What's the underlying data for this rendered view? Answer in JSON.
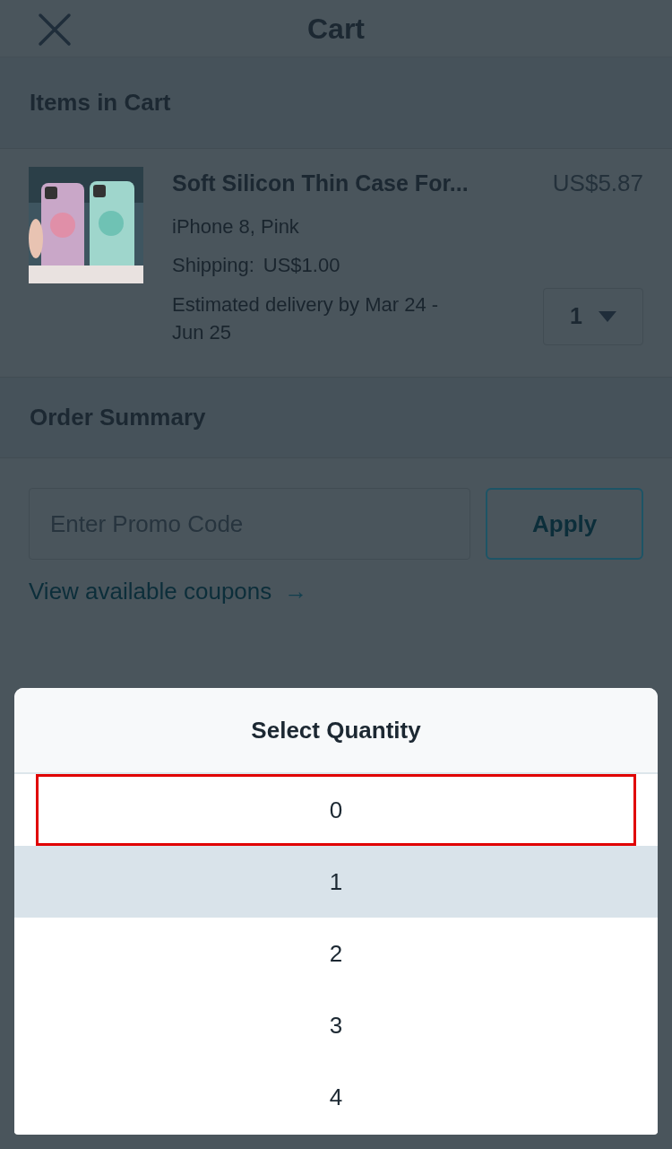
{
  "header": {
    "title": "Cart"
  },
  "items_section": {
    "title": "Items in Cart",
    "items": [
      {
        "name": "Soft Silicon Thin Case For...",
        "price": "US$5.87",
        "variant": "iPhone 8, Pink",
        "shipping_label": "Shipping:",
        "shipping": "US$1.00",
        "delivery": "Estimated delivery by Mar 24 - Jun 25",
        "quantity": "1"
      }
    ]
  },
  "order_summary": {
    "title": "Order Summary",
    "promo": {
      "placeholder": "Enter Promo Code"
    },
    "apply_button": "Apply",
    "coupons_link": "View available coupons",
    "coupons_arrow": "→"
  },
  "quantity_sheet": {
    "title": "Select Quantity",
    "options": [
      {
        "label": "0",
        "selected": false,
        "highlighted": true
      },
      {
        "label": "1",
        "selected": true,
        "highlighted": false
      },
      {
        "label": "2",
        "selected": false,
        "highlighted": false
      },
      {
        "label": "3",
        "selected": false,
        "highlighted": false
      },
      {
        "label": "4",
        "selected": false,
        "highlighted": false
      }
    ]
  }
}
